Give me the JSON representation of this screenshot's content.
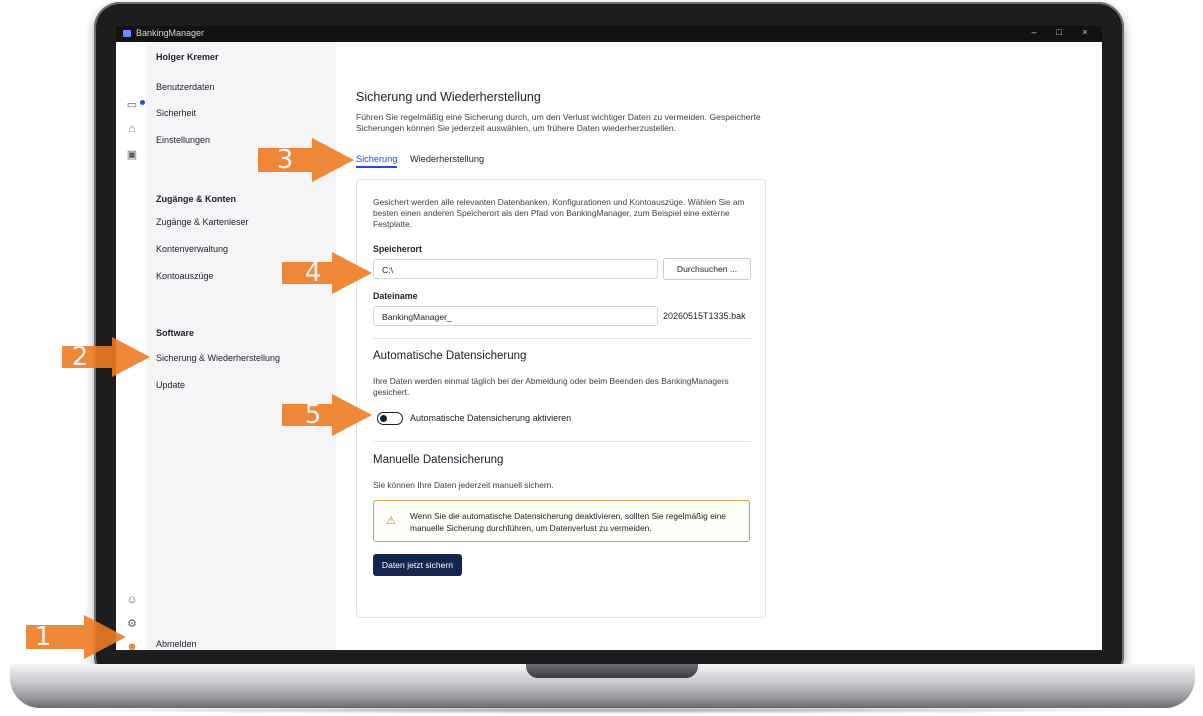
{
  "window": {
    "title": "BankingManager",
    "controls": [
      "–",
      "□",
      "×"
    ]
  },
  "sidebar": {
    "user_name": "Holger Kremer",
    "account_items": [
      {
        "label": "Benutzerdaten",
        "icon": "id-card-icon",
        "glyph": "▭"
      },
      {
        "label": "Sicherheit",
        "icon": "bank-icon",
        "glyph": "⌂"
      },
      {
        "label": "Einstellungen",
        "icon": "settings-screen-icon",
        "glyph": "▣"
      }
    ],
    "section_accounts": "Zugänge & Konten",
    "accounts_items": [
      "Zugänge & Kartenleser",
      "Kontenverwaltung",
      "Kontoauszüge"
    ],
    "section_software": "Software",
    "software_items": [
      "Sicherung & Wiederherstellung",
      "Update"
    ],
    "bottom_icons": [
      {
        "icon": "support-icon",
        "glyph": "☺"
      },
      {
        "icon": "gear-icon",
        "glyph": "⚙"
      },
      {
        "icon": "user-icon",
        "glyph": "☻"
      }
    ],
    "logout_label": "Abmelden"
  },
  "help": {
    "glyph": "?"
  },
  "main": {
    "title": "Sicherung und Wiederherstellung",
    "description": "Führen Sie regelmäßig eine Sicherung durch, um den Verlust wichtiger Daten zu vermeiden. Gespeicherte Sicherungen können Sie jederzeit auswählen, um frühere Daten wiederherzustellen.",
    "tabs": [
      {
        "label": "Sicherung",
        "active": true
      },
      {
        "label": "Wiederherstellung",
        "active": false
      }
    ],
    "card": {
      "description": "Gesichert werden alle relevanten Datenbanken, Konfigurationen und Kontoauszüge. Wählen Sie am besten einen anderen Speicherort als den Pfad von BankingManager, zum Beispiel eine externe Festplatte.",
      "location_label": "Speicherort",
      "location_value": "C:\\",
      "browse_label": "Durchsuchen ...",
      "filename_label": "Dateiname",
      "filename_value": "BankingManager_",
      "filename_suffix": "20260515T1335.bak",
      "auto_title": "Automatische Datensicherung",
      "auto_description": "Ihre Daten werden einmal täglich bei der Abmeldung oder beim Beenden des BankingManagers gesichert.",
      "auto_toggle_label": "Automatische Datensicherung aktivieren",
      "auto_toggle_on": false,
      "manual_title": "Manuelle Datensicherung",
      "manual_description": "Sie können Ihre Daten jederzeit manuell sichern.",
      "warning_glyph": "⚠",
      "warning_text": "Wenn Sie die automatische Datensicherung deaktivieren, sollten Sie regelmäßig eine manuelle Sicherung durchführen, um Datenverlust zu vermeiden.",
      "save_button": "Daten jetzt sichern"
    }
  },
  "callouts": [
    "1",
    "2",
    "3",
    "4",
    "5"
  ],
  "colors": {
    "accent": "#1a4fd6",
    "primary_button": "#14264f",
    "callout_orange": "#ee7b24",
    "warning_border": "#caa44a"
  }
}
